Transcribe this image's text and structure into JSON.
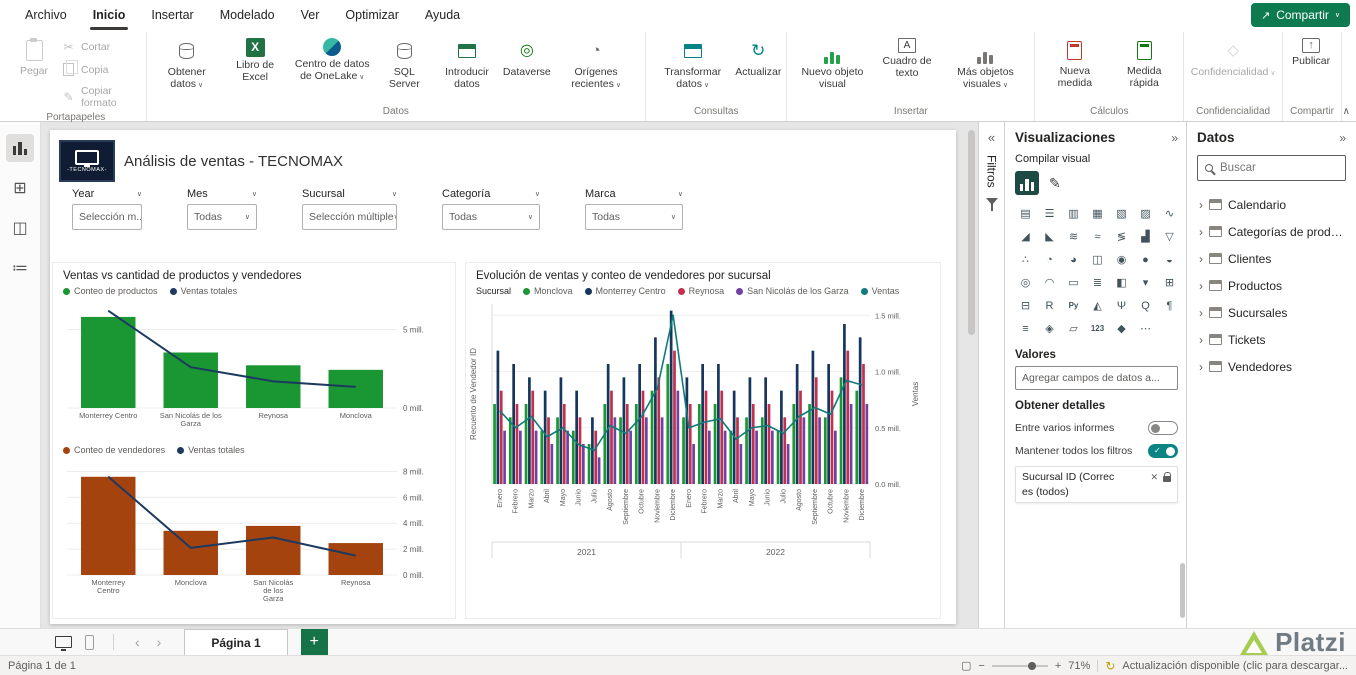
{
  "menubar": {
    "items": [
      "Archivo",
      "Inicio",
      "Insertar",
      "Modelado",
      "Ver",
      "Optimizar",
      "Ayuda"
    ],
    "active_index": 1,
    "share_button": "Compartir"
  },
  "ribbon": {
    "groups": [
      {
        "label": "Portapapeles",
        "buttons": [
          {
            "label": "Pegar",
            "icon": "paste-icon",
            "disabled": true
          },
          {
            "label": "Cortar",
            "icon": "scissors-icon",
            "disabled": true
          },
          {
            "label": "Copia",
            "icon": "copy-icon",
            "disabled": true
          },
          {
            "label": "Copiar formato",
            "icon": "format-painter-icon",
            "disabled": true
          }
        ]
      },
      {
        "label": "Datos",
        "buttons": [
          {
            "label": "Obtener datos",
            "icon": "database-icon",
            "chevron": true
          },
          {
            "label": "Libro de Excel",
            "icon": "excel-icon"
          },
          {
            "label": "Centro de datos de OneLake",
            "icon": "onelake-icon",
            "chevron": true
          },
          {
            "label": "SQL Server",
            "icon": "sql-server-icon"
          },
          {
            "label": "Introducir datos",
            "icon": "enter-data-icon"
          },
          {
            "label": "Dataverse",
            "icon": "dataverse-icon"
          },
          {
            "label": "Orígenes recientes",
            "icon": "recent-sources-icon",
            "chevron": true
          }
        ]
      },
      {
        "label": "Consultas",
        "buttons": [
          {
            "label": "Transformar datos",
            "icon": "transform-data-icon",
            "chevron": true
          },
          {
            "label": "Actualizar",
            "icon": "refresh-icon"
          }
        ]
      },
      {
        "label": "Insertar",
        "buttons": [
          {
            "label": "Nuevo objeto visual",
            "icon": "new-visual-icon"
          },
          {
            "label": "Cuadro de texto",
            "icon": "text-box-icon"
          },
          {
            "label": "Más objetos visuales",
            "icon": "more-visuals-icon",
            "chevron": true
          }
        ]
      },
      {
        "label": "Cálculos",
        "buttons": [
          {
            "label": "Nueva medida",
            "icon": "new-measure-icon"
          },
          {
            "label": "Medida rápida",
            "icon": "quick-measure-icon"
          }
        ]
      },
      {
        "label": "Confidencialidad",
        "buttons": [
          {
            "label": "Confidencialidad",
            "icon": "sensitivity-icon",
            "chevron": true,
            "disabled": true
          }
        ]
      },
      {
        "label": "Compartir",
        "buttons": [
          {
            "label": "Publicar",
            "icon": "publish-icon"
          }
        ]
      }
    ]
  },
  "rail": {
    "items": [
      {
        "name": "report-view",
        "active": true
      },
      {
        "name": "data-view",
        "active": false
      },
      {
        "name": "model-view",
        "active": false
      },
      {
        "name": "dax-query-view",
        "active": false
      }
    ]
  },
  "report": {
    "title": "Análisis de ventas - TECNOMAX",
    "logo_text": "-TECNOMAX-",
    "slicers": [
      {
        "label": "Year",
        "value": "Selección m..."
      },
      {
        "label": "Mes",
        "value": "Todas"
      },
      {
        "label": "Sucursal",
        "value": "Selección múltiple"
      },
      {
        "label": "Categoría",
        "value": "Todas"
      },
      {
        "label": "Marca",
        "value": "Todas"
      }
    ]
  },
  "chart_data": [
    {
      "type": "bar",
      "title": "Ventas vs cantidad de productos y vendedores",
      "legend": [
        {
          "label": "Conteo de productos",
          "color": "#1a9632"
        },
        {
          "label": "Ventas totales",
          "color": "#1c3a5f"
        }
      ],
      "categories": [
        "Monterrey Centro",
        "San Nicolás de los Garza",
        "Reynosa",
        "Monclova"
      ],
      "bar_series": {
        "name": "Conteo de productos",
        "values": [
          4200,
          2560,
          1970,
          1760
        ]
      },
      "line_series": {
        "name": "Ventas totales",
        "values_mill": [
          6.2,
          2.6,
          1.7,
          1.35
        ]
      },
      "y2_ticks": [
        {
          "v": 0,
          "label": "0 mill."
        },
        {
          "v": 5,
          "label": "5 mill."
        }
      ],
      "y2_max_mill": 6.5
    },
    {
      "type": "bar",
      "title": "",
      "legend": [
        {
          "label": "Conteo de vendedores",
          "color": "#a5430f"
        },
        {
          "label": "Ventas totales",
          "color": "#1c3a5f"
        }
      ],
      "categories": [
        "Monterrey Centro",
        "Monclova",
        "San Nicolás de los Garza",
        "Reynosa"
      ],
      "bar_series": {
        "name": "Conteo de vendedores",
        "values": [
          40,
          18,
          20,
          13
        ]
      },
      "line_series": {
        "name": "Ventas totales",
        "values_mill": [
          7.6,
          2.1,
          2.9,
          1.5
        ]
      },
      "y2_ticks": [
        {
          "v": 0,
          "label": "0 mill."
        },
        {
          "v": 2,
          "label": "2 mill."
        },
        {
          "v": 4,
          "label": "4 mill."
        },
        {
          "v": 6,
          "label": "6 mill."
        },
        {
          "v": 8,
          "label": "8 mill."
        }
      ],
      "y2_max_mill": 8.5
    },
    {
      "type": "bar",
      "title": "Evolución de ventas y conteo de vendedores por sucursal",
      "legend_title": "Sucursal",
      "series": [
        {
          "name": "Monclova",
          "color": "#1a9632",
          "values": [
            6,
            5,
            6,
            4,
            5,
            4,
            3,
            6,
            5,
            6,
            7,
            9,
            5,
            6,
            6,
            4,
            5,
            5,
            4,
            6,
            6,
            5,
            8,
            7
          ]
        },
        {
          "name": "Monterrey Centro",
          "color": "#16365c",
          "values": [
            10,
            9,
            8,
            7,
            8,
            7,
            5,
            9,
            8,
            9,
            11,
            13,
            8,
            9,
            9,
            7,
            8,
            8,
            7,
            9,
            10,
            9,
            12,
            11
          ]
        },
        {
          "name": "Reynosa",
          "color": "#c22f4f",
          "values": [
            7,
            6,
            7,
            5,
            6,
            5,
            4,
            7,
            6,
            7,
            8,
            10,
            6,
            7,
            7,
            5,
            6,
            6,
            5,
            7,
            8,
            7,
            10,
            9
          ]
        },
        {
          "name": "San Nicolás de los Garza",
          "color": "#7141a1",
          "values": [
            4,
            4,
            4,
            3,
            4,
            3,
            2,
            5,
            4,
            5,
            5,
            7,
            3,
            4,
            4,
            3,
            4,
            4,
            3,
            5,
            5,
            4,
            6,
            6
          ]
        }
      ],
      "line": {
        "name": "Ventas",
        "color": "#0f7b7b",
        "values_mill": [
          0.65,
          0.5,
          0.6,
          0.42,
          0.5,
          0.35,
          0.3,
          0.52,
          0.45,
          0.6,
          0.85,
          1.5,
          0.5,
          0.55,
          0.58,
          0.4,
          0.5,
          0.52,
          0.45,
          0.6,
          0.68,
          0.62,
          0.92,
          0.88
        ]
      },
      "x_months": [
        "Enero",
        "Febrero",
        "Marzo",
        "Abril",
        "Mayo",
        "Junio",
        "Julio",
        "Agosto",
        "Septiembre",
        "Octubre",
        "Noviembre",
        "Diciembre"
      ],
      "years": [
        "2021",
        "2022"
      ],
      "y1_label": "Recuento de Vendedor ID",
      "y2_label": "Ventas",
      "y2_ticks": [
        {
          "v": 0,
          "label": "0.0 mill."
        },
        {
          "v": 0.5,
          "label": "0.5 mill."
        },
        {
          "v": 1,
          "label": "1.0 mill."
        },
        {
          "v": 1.5,
          "label": "1.5 mill."
        }
      ],
      "y2_max_mill": 1.6
    }
  ],
  "filters": {
    "label": "Filtros"
  },
  "panels": {
    "visualizations": {
      "title": "Visualizaciones",
      "build_label": "Compilar visual",
      "values_label": "Valores",
      "add_fields_placeholder": "Agregar campos de datos a...",
      "drill_label": "Obtener detalles",
      "cross_report_label": "Entre varios informes",
      "cross_report_on": false,
      "keep_filters_label": "Mantener todos los filtros",
      "keep_filters_on": true,
      "drill_field": {
        "line1": "Sucursal ID (Correc",
        "line2": "es (todos)"
      },
      "visual_icons": [
        {
          "name": "stacked-bar",
          "glyph": "▤"
        },
        {
          "name": "clustered-bar",
          "glyph": "☰"
        },
        {
          "name": "stacked-column",
          "glyph": "▥"
        },
        {
          "name": "clustered-column",
          "glyph": "▦"
        },
        {
          "name": "100-stacked-bar",
          "glyph": "▧"
        },
        {
          "name": "100-stacked-column",
          "glyph": "▨"
        },
        {
          "name": "line",
          "glyph": "∿"
        },
        {
          "name": "area",
          "glyph": "◢"
        },
        {
          "name": "stacked-area",
          "glyph": "◣"
        },
        {
          "name": "line-stacked-column",
          "glyph": "≋"
        },
        {
          "name": "line-clustered-column",
          "glyph": "≈"
        },
        {
          "name": "ribbon",
          "glyph": "≶"
        },
        {
          "name": "waterfall",
          "glyph": "▟"
        },
        {
          "name": "funnel",
          "glyph": "▽"
        },
        {
          "name": "scatter",
          "glyph": "∴"
        },
        {
          "name": "pie",
          "glyph": "◔"
        },
        {
          "name": "donut",
          "glyph": "◕"
        },
        {
          "name": "treemap",
          "glyph": "◫"
        },
        {
          "name": "map",
          "glyph": "◉"
        },
        {
          "name": "filled-map",
          "glyph": "●"
        },
        {
          "name": "shape-map",
          "glyph": "◒"
        },
        {
          "name": "azure-map",
          "glyph": "◎"
        },
        {
          "name": "gauge",
          "glyph": "◠"
        },
        {
          "name": "card",
          "glyph": "▭"
        },
        {
          "name": "multirow-card",
          "glyph": "≣"
        },
        {
          "name": "kpi",
          "glyph": "◧"
        },
        {
          "name": "slicer",
          "glyph": "▾"
        },
        {
          "name": "table",
          "glyph": "⊞"
        },
        {
          "name": "matrix",
          "glyph": "⊟"
        },
        {
          "name": "r-script",
          "glyph": "R"
        },
        {
          "name": "python",
          "glyph": "Py"
        },
        {
          "name": "key-influencers",
          "glyph": "◭"
        },
        {
          "name": "decomposition-tree",
          "glyph": "Ψ"
        },
        {
          "name": "qa",
          "glyph": "Q"
        },
        {
          "name": "smart-narrative",
          "glyph": "¶"
        },
        {
          "name": "paginated-report",
          "glyph": "≡"
        },
        {
          "name": "arcgis",
          "glyph": "◈"
        },
        {
          "name": "power-apps",
          "glyph": "▱"
        },
        {
          "name": "metrics",
          "glyph": "123"
        },
        {
          "name": "goals",
          "glyph": "◆"
        },
        {
          "name": "more-visuals",
          "glyph": "⋯"
        }
      ]
    },
    "data": {
      "title": "Datos",
      "search_placeholder": "Buscar",
      "tables": [
        "Calendario",
        "Categorías de product...",
        "Clientes",
        "Productos",
        "Sucursales",
        "Tickets",
        "Vendedores"
      ]
    }
  },
  "bottom": {
    "page_tab": "Página 1"
  },
  "status": {
    "page_indicator": "Página 1 de 1",
    "zoom": "71%",
    "update_text": "Actualización disponible (clic para descargar..."
  },
  "watermark": {
    "text": "Platzi"
  },
  "colors": {
    "accent_green": "#0e7a4f",
    "bar_green": "#1a9632",
    "bar_brown": "#a5430f",
    "line_navy": "#1c3a5f",
    "line_teal": "#0f7b7b",
    "toggle_teal": "#0b8484",
    "new_page_green": "#157347"
  }
}
